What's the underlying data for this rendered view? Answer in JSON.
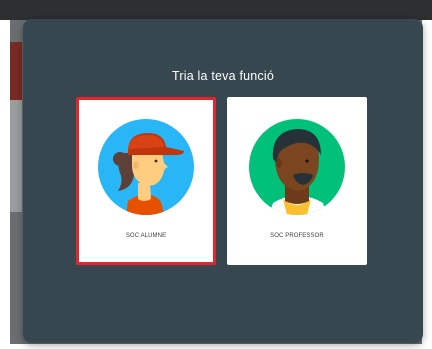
{
  "dialog": {
    "title": "Tria la teva funció",
    "roles": [
      {
        "label": "SOC ALUMNE",
        "icon": "student-avatar-icon",
        "selected": true
      },
      {
        "label": "SOC PROFESSOR",
        "icon": "teacher-avatar-icon",
        "selected": false
      }
    ]
  },
  "colors": {
    "dialog_bg": "#37474f",
    "selection_border": "#e2262b",
    "student_circle": "#29b6f6",
    "teacher_circle": "#00c07a"
  }
}
